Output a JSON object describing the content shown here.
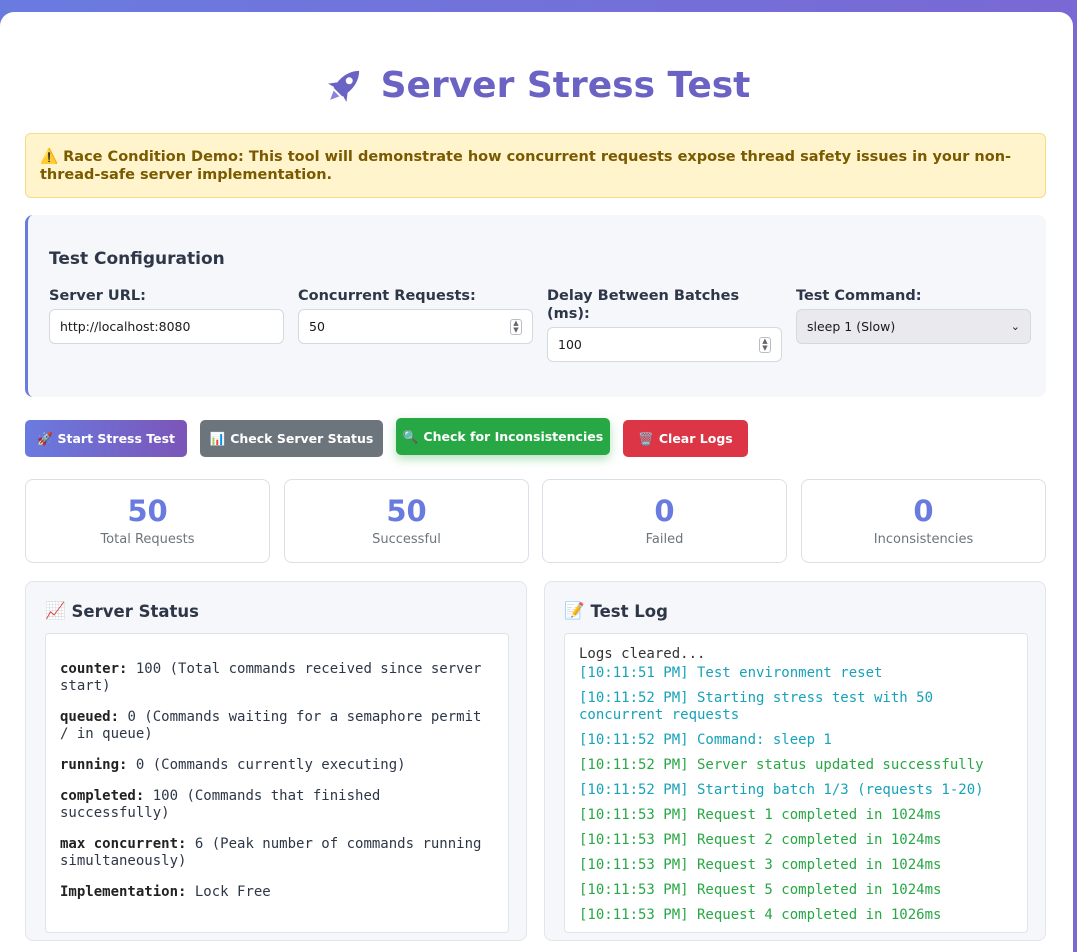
{
  "header": {
    "title": "Server Stress Test",
    "icon": "rocket-icon"
  },
  "warning": {
    "icon": "⚠️",
    "text": "Race Condition Demo: This tool will demonstrate how concurrent requests expose thread safety issues in your non-thread-safe server implementation."
  },
  "config": {
    "title": "Test Configuration",
    "server_url": {
      "label": "Server URL:",
      "value": "http://localhost:8080"
    },
    "concurrent": {
      "label": "Concurrent Requests:",
      "value": "50"
    },
    "delay": {
      "label": "Delay Between Batches (ms):",
      "value": "100"
    },
    "command": {
      "label": "Test Command:",
      "value": "sleep 1 (Slow)"
    }
  },
  "buttons": {
    "start": {
      "icon": "🚀",
      "label": "Start Stress Test"
    },
    "status": {
      "icon": "📊",
      "label": "Check Server Status"
    },
    "inconsistencies": {
      "icon": "🔍",
      "label": "Check for Inconsistencies"
    },
    "clear": {
      "icon": "🗑️",
      "label": "Clear Logs"
    }
  },
  "stats": [
    {
      "value": "50",
      "label": "Total Requests"
    },
    {
      "value": "50",
      "label": "Successful"
    },
    {
      "value": "0",
      "label": "Failed"
    },
    {
      "value": "0",
      "label": "Inconsistencies"
    }
  ],
  "server_status": {
    "icon": "📈",
    "title": "Server Status",
    "rows": [
      {
        "key": "counter:",
        "text": " 100 (Total commands received since server start)"
      },
      {
        "key": "queued:",
        "text": " 0 (Commands waiting for a semaphore permit / in queue)"
      },
      {
        "key": "running:",
        "text": " 0 (Commands currently executing)"
      },
      {
        "key": "completed:",
        "text": " 100 (Commands that finished successfully)"
      },
      {
        "key": "max concurrent:",
        "text": " 6 (Peak number of commands running simultaneously)"
      },
      {
        "key": "Implementation:",
        "text": " Lock Free"
      }
    ]
  },
  "test_log": {
    "icon": "📝",
    "title": "Test Log",
    "cleared": "Logs cleared...",
    "entries": [
      {
        "type": "info",
        "text": "[10:11:51 PM] Test environment reset"
      },
      {
        "type": "info",
        "text": "[10:11:52 PM] Starting stress test with 50 concurrent requests"
      },
      {
        "type": "info",
        "text": "[10:11:52 PM] Command: sleep 1"
      },
      {
        "type": "success",
        "text": "[10:11:52 PM] Server status updated successfully"
      },
      {
        "type": "info",
        "text": "[10:11:52 PM] Starting batch 1/3 (requests 1-20)"
      },
      {
        "type": "success",
        "text": "[10:11:53 PM] Request 1 completed in 1024ms"
      },
      {
        "type": "success",
        "text": "[10:11:53 PM] Request 2 completed in 1024ms"
      },
      {
        "type": "success",
        "text": "[10:11:53 PM] Request 3 completed in 1024ms"
      },
      {
        "type": "success",
        "text": "[10:11:53 PM] Request 5 completed in 1024ms"
      },
      {
        "type": "success",
        "text": "[10:11:53 PM] Request 4 completed in 1026ms"
      }
    ]
  },
  "colors": {
    "accent": "#6a7be0",
    "success": "#28a745",
    "info": "#17a2b8",
    "danger": "#dc3545"
  }
}
